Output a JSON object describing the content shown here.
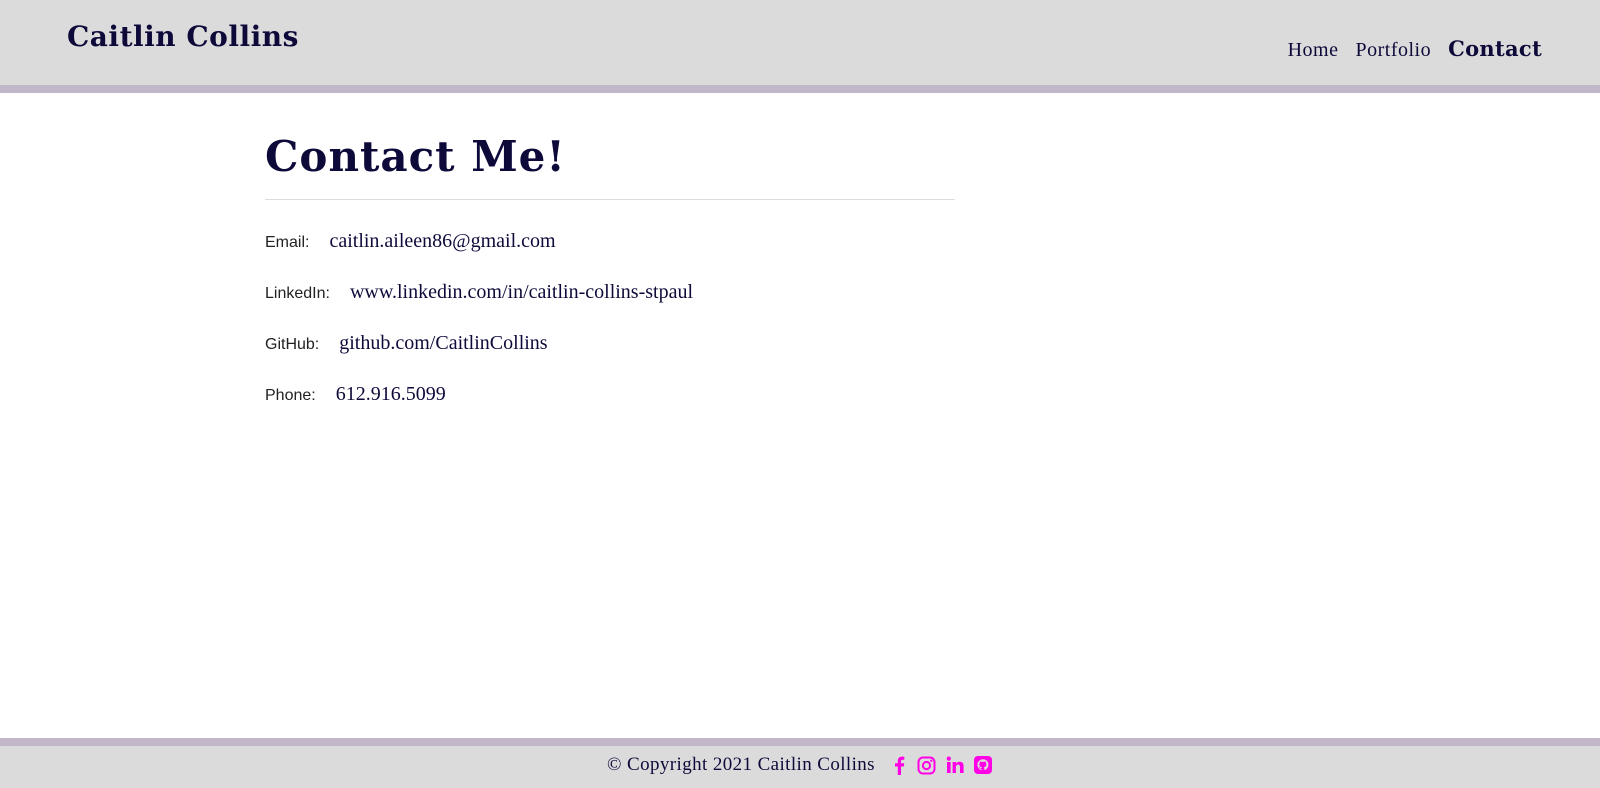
{
  "header": {
    "brand": "Caitlin Collins",
    "nav": [
      {
        "label": "Home"
      },
      {
        "label": "Portfolio"
      },
      {
        "label": "Contact",
        "active": true
      }
    ]
  },
  "main": {
    "title": "Contact Me!",
    "contacts": [
      {
        "label": "Email:",
        "value": "caitlin.aileen86@gmail.com"
      },
      {
        "label": "LinkedIn:",
        "value": "www.linkedin.com/in/caitlin-collins-stpaul"
      },
      {
        "label": "GitHub:",
        "value": "github.com/CaitlinCollins"
      },
      {
        "label": "Phone:",
        "value": "612.916.5099"
      }
    ]
  },
  "footer": {
    "copyright": "© Copyright 2021 Caitlin Collins",
    "social_icons": [
      "facebook-icon",
      "instagram-icon",
      "linkedin-icon",
      "github-icon"
    ]
  },
  "colors": {
    "header_bg": "#dcdbdb",
    "accent_border": "#c1b7c8",
    "text_navy": "#0d0a3a",
    "icon_magenta": "#ff00e6"
  }
}
